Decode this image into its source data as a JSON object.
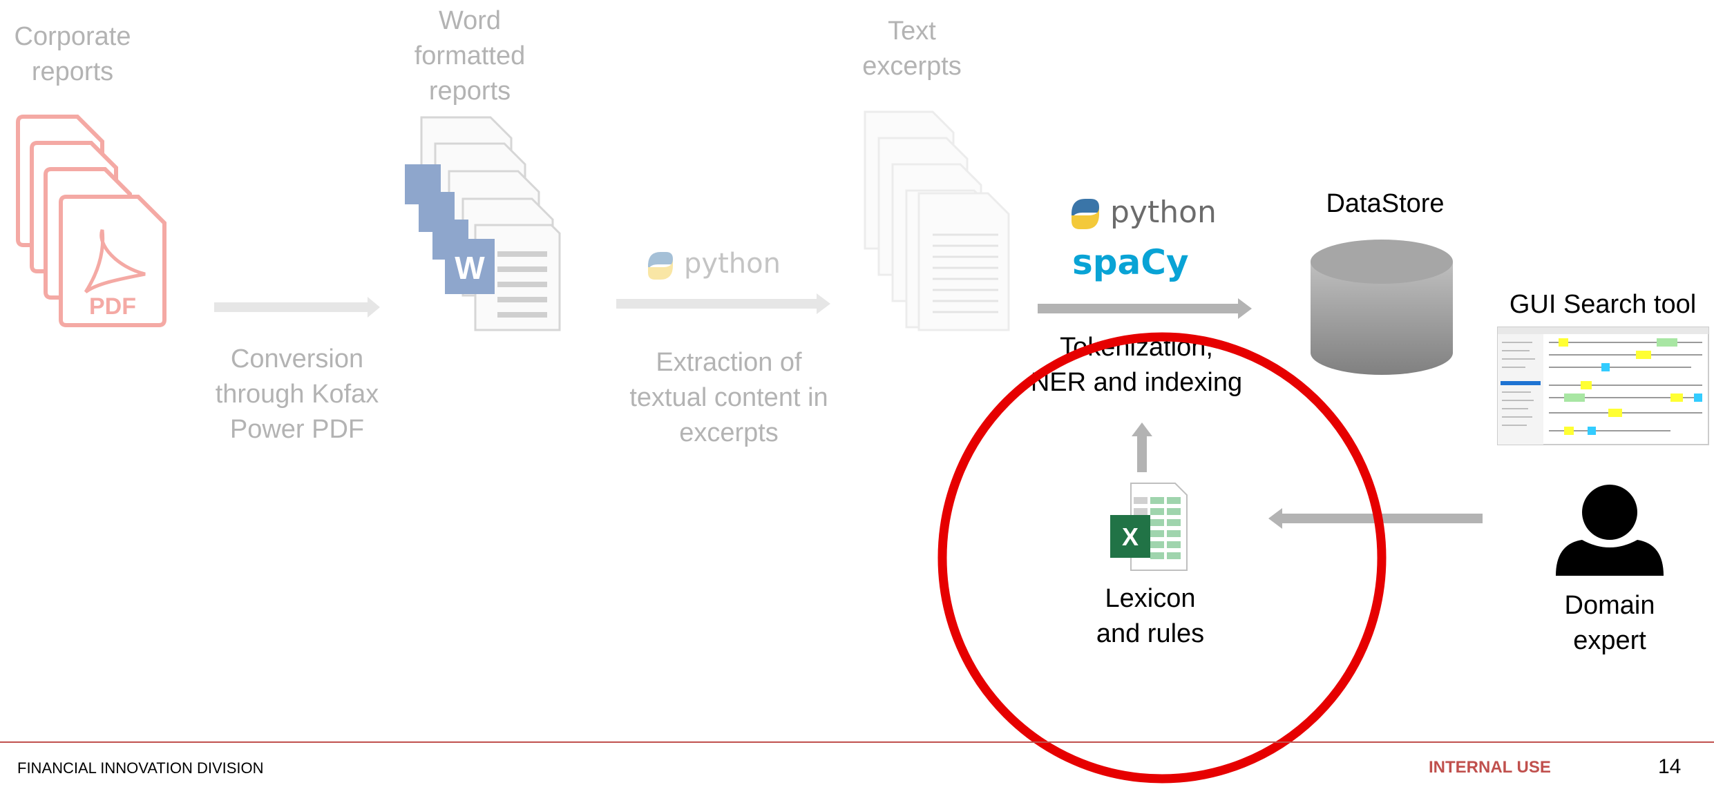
{
  "steps": {
    "corporate_reports": {
      "lines": [
        "Corporate",
        "reports"
      ]
    },
    "pdf_icon": {
      "label": "PDF"
    },
    "conversion": {
      "lines": [
        "Conversion",
        "through Kofax",
        "Power PDF"
      ]
    },
    "word_reports": {
      "lines": [
        "Word",
        "formatted",
        "reports"
      ]
    },
    "word_icon": {
      "label": "W"
    },
    "extraction_logo": {
      "label": "python"
    },
    "extraction": {
      "lines": [
        "Extraction of",
        "textual content in",
        "excerpts"
      ]
    },
    "text_excerpts": {
      "lines": [
        "Text",
        "excerpts"
      ]
    },
    "nlp_logos": {
      "python": "python",
      "spacy": "spaCy"
    },
    "tokenization": {
      "lines": [
        "Tokenization,",
        "NER and indexing"
      ]
    },
    "datastore": {
      "label": "DataStore"
    },
    "gui": {
      "label": "GUI Search tool"
    },
    "lexicon_icon": {
      "label": "X"
    },
    "lexicon": {
      "lines": [
        "Lexicon",
        "and rules"
      ]
    },
    "domain_expert": {
      "lines": [
        "Domain",
        "expert"
      ]
    }
  },
  "footer": {
    "division": "FINANCIAL INNOVATION DIVISION",
    "classification": "INTERNAL USE",
    "page_number": "14"
  },
  "colors": {
    "faded_text": "#b3b3b3",
    "pdf_red": "#f4a9a4",
    "word_blue": "#8ea6cc",
    "excel_green": "#217346",
    "python_blue": "#3a75a8",
    "python_yellow": "#f3c93a",
    "spacy_blue": "#09a3d5",
    "highlight_circle": "#e60000",
    "footer_accent": "#c0504d",
    "cylinder_gray": "#8c8c8c"
  }
}
